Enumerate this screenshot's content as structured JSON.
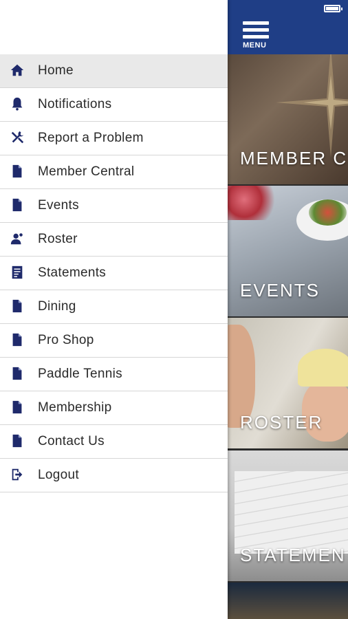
{
  "status_bar": {
    "battery_icon": "battery-icon"
  },
  "header": {
    "menu_label": "MENU",
    "menu_icon": "hamburger-icon",
    "color": "#1f3e86"
  },
  "drawer": {
    "items": [
      {
        "label": "Home",
        "icon": "home-icon",
        "active": true
      },
      {
        "label": "Notifications",
        "icon": "bell-icon"
      },
      {
        "label": "Report a Problem",
        "icon": "tools-icon"
      },
      {
        "label": "Member Central",
        "icon": "page-icon"
      },
      {
        "label": "Events",
        "icon": "page-icon"
      },
      {
        "label": "Roster",
        "icon": "people-icon"
      },
      {
        "label": "Statements",
        "icon": "statement-icon"
      },
      {
        "label": "Dining",
        "icon": "page-icon"
      },
      {
        "label": "Pro Shop",
        "icon": "page-icon"
      },
      {
        "label": "Paddle Tennis",
        "icon": "page-icon"
      },
      {
        "label": "Membership",
        "icon": "page-icon"
      },
      {
        "label": "Contact Us",
        "icon": "page-icon"
      },
      {
        "label": "Logout",
        "icon": "logout-icon"
      }
    ]
  },
  "tiles": [
    {
      "label": "MEMBER C"
    },
    {
      "label": "EVENTS"
    },
    {
      "label": "ROSTER"
    },
    {
      "label": "STATEMEN"
    }
  ],
  "colors": {
    "icon": "#1f2a6b",
    "active_row": "#e9e9e9",
    "accent": "#1f3e86"
  }
}
